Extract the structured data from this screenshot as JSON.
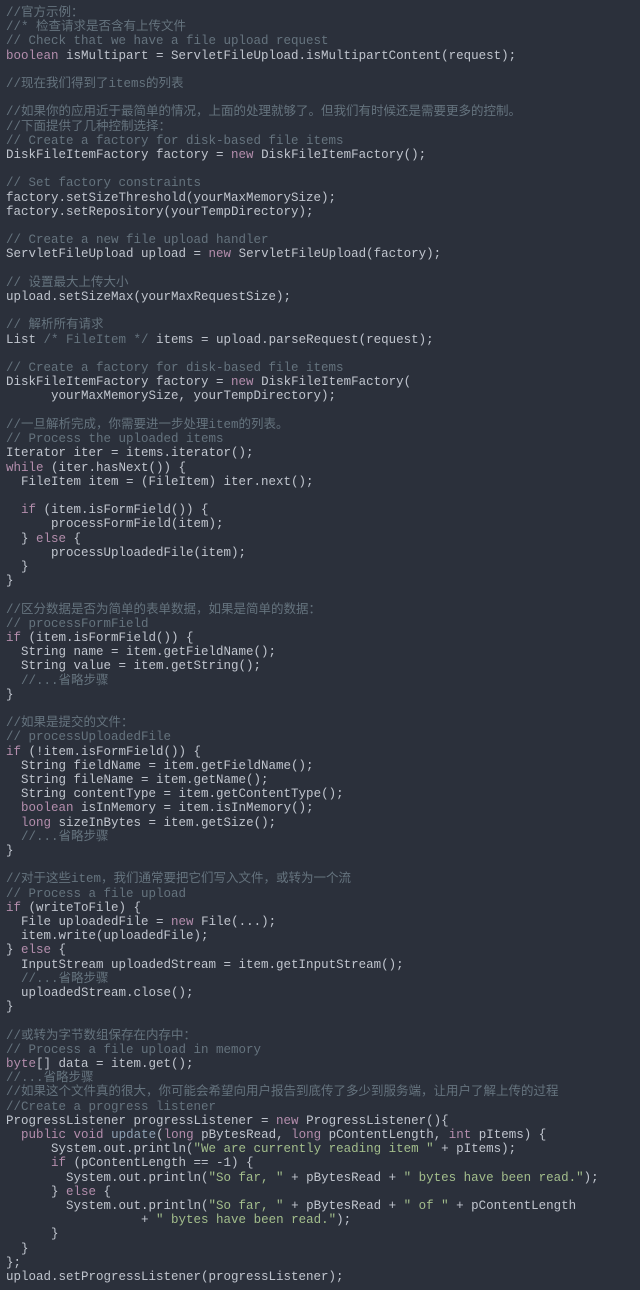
{
  "code": {
    "lines": [
      [
        [
          "c",
          "//官方示例："
        ]
      ],
      [
        [
          "c",
          "//* 检查请求是否含有上传文件"
        ]
      ],
      [
        [
          "c",
          "// Check that we have a file upload request"
        ]
      ],
      [
        [
          "k",
          "boolean"
        ],
        [
          "t",
          " isMultipart = ServletFileUpload.isMultipartContent(request);"
        ]
      ],
      [
        [
          "t",
          ""
        ]
      ],
      [
        [
          "c",
          "//现在我们得到了items的列表"
        ]
      ],
      [
        [
          "t",
          ""
        ]
      ],
      [
        [
          "c",
          "//如果你的应用近于最简单的情况，上面的处理就够了。但我们有时候还是需要更多的控制。"
        ]
      ],
      [
        [
          "c",
          "//下面提供了几种控制选择："
        ]
      ],
      [
        [
          "c",
          "// Create a factory for disk-based file items"
        ]
      ],
      [
        [
          "t",
          "DiskFileItemFactory factory = "
        ],
        [
          "k",
          "new"
        ],
        [
          "t",
          " DiskFileItemFactory();"
        ]
      ],
      [
        [
          "t",
          ""
        ]
      ],
      [
        [
          "c",
          "// Set factory constraints"
        ]
      ],
      [
        [
          "t",
          "factory.setSizeThreshold(yourMaxMemorySize);"
        ]
      ],
      [
        [
          "t",
          "factory.setRepository(yourTempDirectory);"
        ]
      ],
      [
        [
          "t",
          ""
        ]
      ],
      [
        [
          "c",
          "// Create a new file upload handler"
        ]
      ],
      [
        [
          "t",
          "ServletFileUpload upload = "
        ],
        [
          "k",
          "new"
        ],
        [
          "t",
          " ServletFileUpload(factory);"
        ]
      ],
      [
        [
          "t",
          ""
        ]
      ],
      [
        [
          "c",
          "// 设置最大上传大小"
        ]
      ],
      [
        [
          "t",
          "upload.setSizeMax(yourMaxRequestSize);"
        ]
      ],
      [
        [
          "t",
          ""
        ]
      ],
      [
        [
          "c",
          "// 解析所有请求"
        ]
      ],
      [
        [
          "t",
          "List "
        ],
        [
          "c",
          "/* FileItem */"
        ],
        [
          "t",
          " items = upload.parseRequest(request);"
        ]
      ],
      [
        [
          "t",
          ""
        ]
      ],
      [
        [
          "c",
          "// Create a factory for disk-based file items"
        ]
      ],
      [
        [
          "t",
          "DiskFileItemFactory factory = "
        ],
        [
          "k",
          "new"
        ],
        [
          "t",
          " DiskFileItemFactory("
        ]
      ],
      [
        [
          "t",
          "      yourMaxMemorySize, yourTempDirectory);"
        ]
      ],
      [
        [
          "t",
          ""
        ]
      ],
      [
        [
          "c",
          "//一旦解析完成，你需要进一步处理item的列表。"
        ]
      ],
      [
        [
          "c",
          "// Process the uploaded items"
        ]
      ],
      [
        [
          "t",
          "Iterator iter = items.iterator();"
        ]
      ],
      [
        [
          "k",
          "while"
        ],
        [
          "t",
          " (iter.hasNext()) {"
        ]
      ],
      [
        [
          "t",
          "  FileItem item = (FileItem) iter.next();"
        ]
      ],
      [
        [
          "t",
          ""
        ]
      ],
      [
        [
          "t",
          "  "
        ],
        [
          "k",
          "if"
        ],
        [
          "t",
          " (item.isFormField()) {"
        ]
      ],
      [
        [
          "t",
          "      processFormField(item);"
        ]
      ],
      [
        [
          "t",
          "  } "
        ],
        [
          "k",
          "else"
        ],
        [
          "t",
          " {"
        ]
      ],
      [
        [
          "t",
          "      processUploadedFile(item);"
        ]
      ],
      [
        [
          "t",
          "  }"
        ]
      ],
      [
        [
          "t",
          "}"
        ]
      ],
      [
        [
          "t",
          ""
        ]
      ],
      [
        [
          "c",
          "//区分数据是否为简单的表单数据，如果是简单的数据："
        ]
      ],
      [
        [
          "c",
          "// processFormField"
        ]
      ],
      [
        [
          "k",
          "if"
        ],
        [
          "t",
          " (item.isFormField()) {"
        ]
      ],
      [
        [
          "t",
          "  String name = item.getFieldName();"
        ]
      ],
      [
        [
          "t",
          "  String value = item.getString();"
        ]
      ],
      [
        [
          "t",
          "  "
        ],
        [
          "c",
          "//...省略步骤"
        ]
      ],
      [
        [
          "t",
          "}"
        ]
      ],
      [
        [
          "t",
          ""
        ]
      ],
      [
        [
          "c",
          "//如果是提交的文件："
        ]
      ],
      [
        [
          "c",
          "// processUploadedFile"
        ]
      ],
      [
        [
          "k",
          "if"
        ],
        [
          "t",
          " (!item.isFormField()) {"
        ]
      ],
      [
        [
          "t",
          "  String fieldName = item.getFieldName();"
        ]
      ],
      [
        [
          "t",
          "  String fileName = item.getName();"
        ]
      ],
      [
        [
          "t",
          "  String contentType = item.getContentType();"
        ]
      ],
      [
        [
          "t",
          "  "
        ],
        [
          "k",
          "boolean"
        ],
        [
          "t",
          " isInMemory = item.isInMemory();"
        ]
      ],
      [
        [
          "t",
          "  "
        ],
        [
          "k",
          "long"
        ],
        [
          "t",
          " sizeInBytes = item.getSize();"
        ]
      ],
      [
        [
          "t",
          "  "
        ],
        [
          "c",
          "//...省略步骤"
        ]
      ],
      [
        [
          "t",
          "}"
        ]
      ],
      [
        [
          "t",
          ""
        ]
      ],
      [
        [
          "c",
          "//对于这些item，我们通常要把它们写入文件，或转为一个流"
        ]
      ],
      [
        [
          "c",
          "// Process a file upload"
        ]
      ],
      [
        [
          "k",
          "if"
        ],
        [
          "t",
          " (writeToFile) {"
        ]
      ],
      [
        [
          "t",
          "  File uploadedFile = "
        ],
        [
          "k",
          "new"
        ],
        [
          "t",
          " File(...);"
        ]
      ],
      [
        [
          "t",
          "  item.write(uploadedFile);"
        ]
      ],
      [
        [
          "t",
          "} "
        ],
        [
          "k",
          "else"
        ],
        [
          "t",
          " {"
        ]
      ],
      [
        [
          "t",
          "  InputStream uploadedStream = item.getInputStream();"
        ]
      ],
      [
        [
          "t",
          "  "
        ],
        [
          "c",
          "//...省略步骤"
        ]
      ],
      [
        [
          "t",
          "  uploadedStream.close();"
        ]
      ],
      [
        [
          "t",
          "}"
        ]
      ],
      [
        [
          "t",
          ""
        ]
      ],
      [
        [
          "c",
          "//或转为字节数组保存在内存中："
        ]
      ],
      [
        [
          "c",
          "// Process a file upload in memory"
        ]
      ],
      [
        [
          "k",
          "byte"
        ],
        [
          "t",
          "[] data = item.get();"
        ]
      ],
      [
        [
          "c",
          "//...省略步骤"
        ]
      ],
      [
        [
          "c",
          "//如果这个文件真的很大，你可能会希望向用户报告到底传了多少到服务端，让用户了解上传的过程"
        ]
      ],
      [
        [
          "c",
          "//Create a progress listener"
        ]
      ],
      [
        [
          "t",
          "ProgressListener progressListener = "
        ],
        [
          "k",
          "new"
        ],
        [
          "t",
          " ProgressListener(){"
        ]
      ],
      [
        [
          "t",
          "  "
        ],
        [
          "k",
          "public"
        ],
        [
          "t",
          " "
        ],
        [
          "k",
          "void"
        ],
        [
          "t",
          " "
        ],
        [
          "fn",
          "update"
        ],
        [
          "t",
          "("
        ],
        [
          "k",
          "long"
        ],
        [
          "t",
          " pBytesRead, "
        ],
        [
          "k",
          "long"
        ],
        [
          "t",
          " pContentLength, "
        ],
        [
          "k",
          "int"
        ],
        [
          "t",
          " pItems) {"
        ]
      ],
      [
        [
          "t",
          "      System.out.println("
        ],
        [
          "s",
          "\"We are currently reading item \""
        ],
        [
          "t",
          " + pItems);"
        ]
      ],
      [
        [
          "t",
          "      "
        ],
        [
          "k",
          "if"
        ],
        [
          "t",
          " (pContentLength == -1) {"
        ]
      ],
      [
        [
          "t",
          "        System.out.println("
        ],
        [
          "s",
          "\"So far, \""
        ],
        [
          "t",
          " + pBytesRead + "
        ],
        [
          "s",
          "\" bytes have been read.\""
        ],
        [
          "t",
          ");"
        ]
      ],
      [
        [
          "t",
          "      } "
        ],
        [
          "k",
          "else"
        ],
        [
          "t",
          " {"
        ]
      ],
      [
        [
          "t",
          "        System.out.println("
        ],
        [
          "s",
          "\"So far, \""
        ],
        [
          "t",
          " + pBytesRead + "
        ],
        [
          "s",
          "\" of \""
        ],
        [
          "t",
          " + pContentLength"
        ]
      ],
      [
        [
          "t",
          "                  + "
        ],
        [
          "s",
          "\" bytes have been read.\""
        ],
        [
          "t",
          ");"
        ]
      ],
      [
        [
          "t",
          "      }"
        ]
      ],
      [
        [
          "t",
          "  }"
        ]
      ],
      [
        [
          "t",
          "};"
        ]
      ],
      [
        [
          "t",
          "upload.setProgressListener(progressListener);"
        ]
      ]
    ]
  }
}
